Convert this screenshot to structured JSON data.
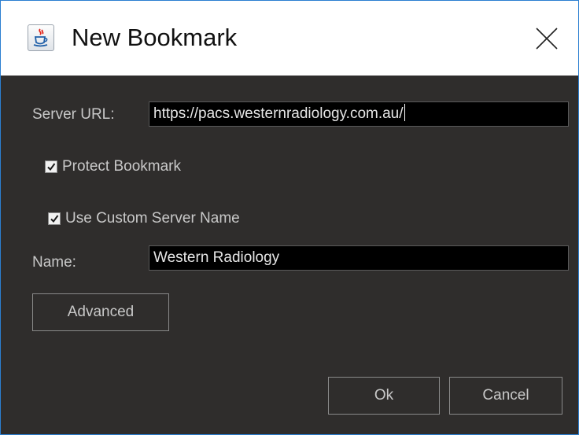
{
  "window": {
    "title": "New Bookmark",
    "icon": "java-cup-icon",
    "close_icon": "close-icon"
  },
  "form": {
    "server_url_label": "Server URL:",
    "server_url_value": "https://pacs.westernradiology.com.au/",
    "protect_bookmark_label": "Protect Bookmark",
    "protect_bookmark_checked": true,
    "custom_name_label": "Use Custom Server Name",
    "custom_name_checked": true,
    "name_label": "Name:",
    "name_value": "Western Radiology"
  },
  "buttons": {
    "advanced": "Advanced",
    "ok": "Ok",
    "cancel": "Cancel"
  },
  "colors": {
    "dialog_background": "#2f2d2c",
    "input_background": "#000000",
    "text": "#c8c8c8",
    "window_border": "#2b7fd1"
  }
}
